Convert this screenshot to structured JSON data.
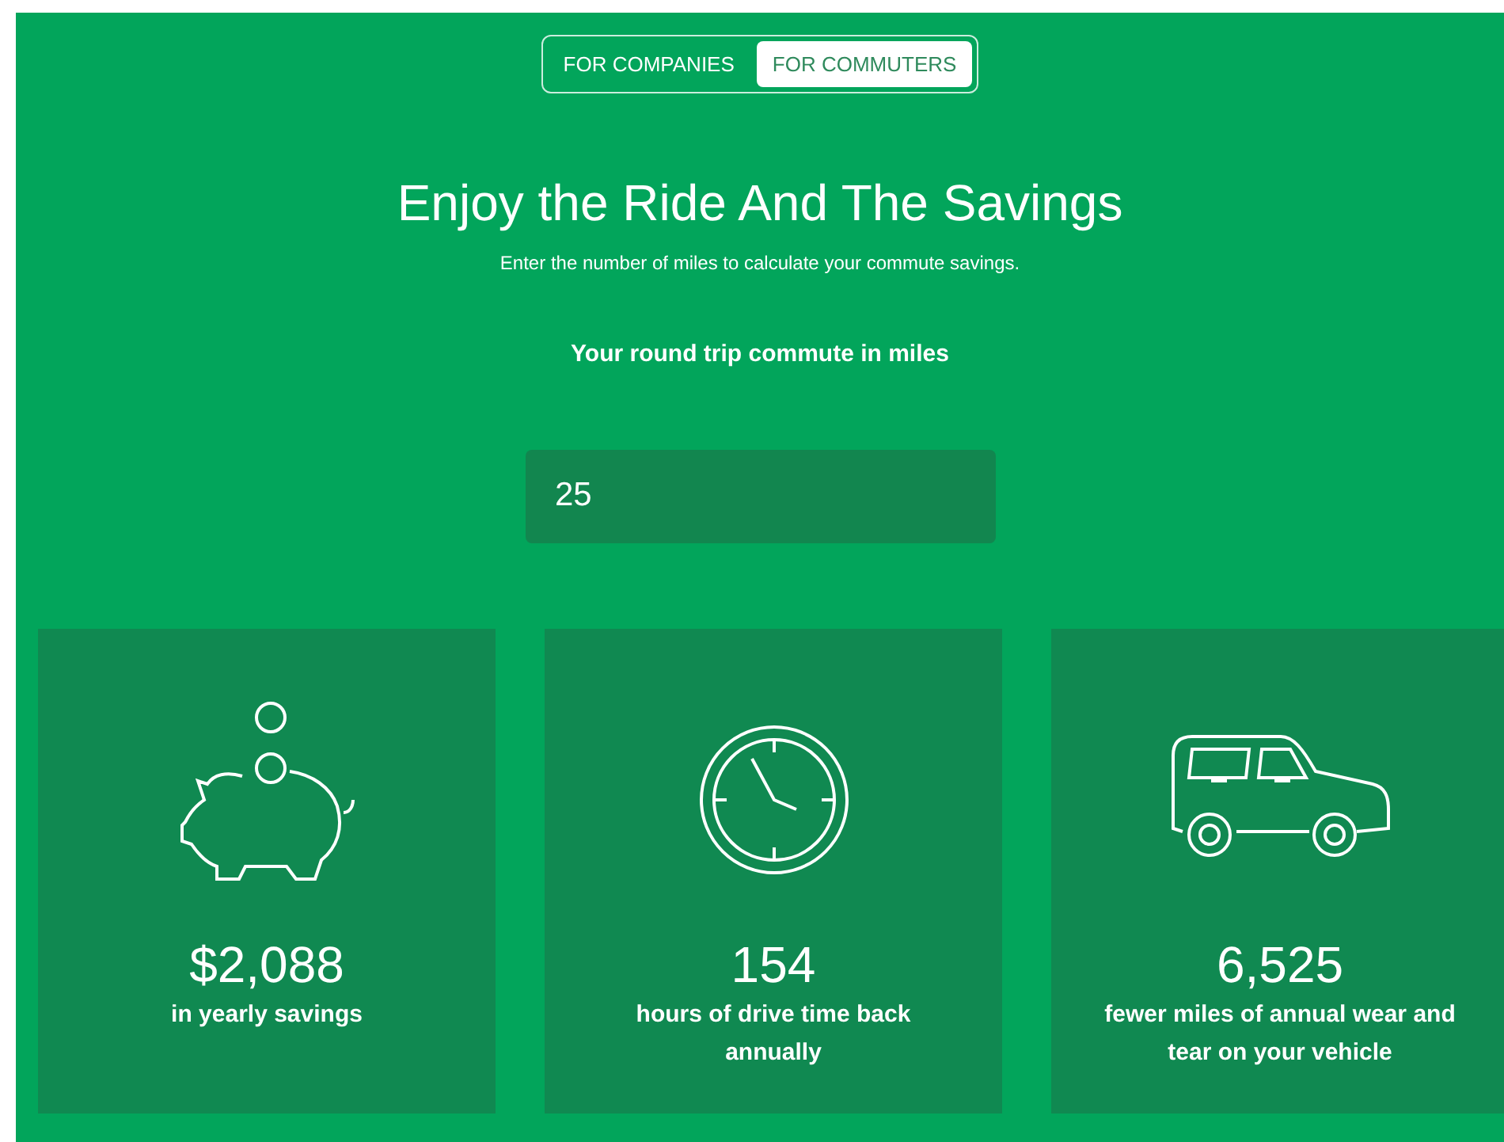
{
  "tabs": [
    {
      "label": "FOR COMPANIES",
      "selected": false
    },
    {
      "label": "FOR COMMUTERS",
      "selected": true
    }
  ],
  "heading": "Enjoy the Ride And The Savings",
  "subheading": "Enter the number of miles to calculate your commute savings.",
  "input_label": "Your round trip commute in miles",
  "miles_field": {
    "value": "25"
  },
  "stats": [
    {
      "kind": "piggy",
      "value": "$2,088",
      "caption": "in yearly savings"
    },
    {
      "kind": "clock",
      "value": "154",
      "caption": "hours of drive time back annually"
    },
    {
      "kind": "car",
      "value": "6,525",
      "caption": "fewer miles of annual wear and tear on your vehicle"
    }
  ]
}
